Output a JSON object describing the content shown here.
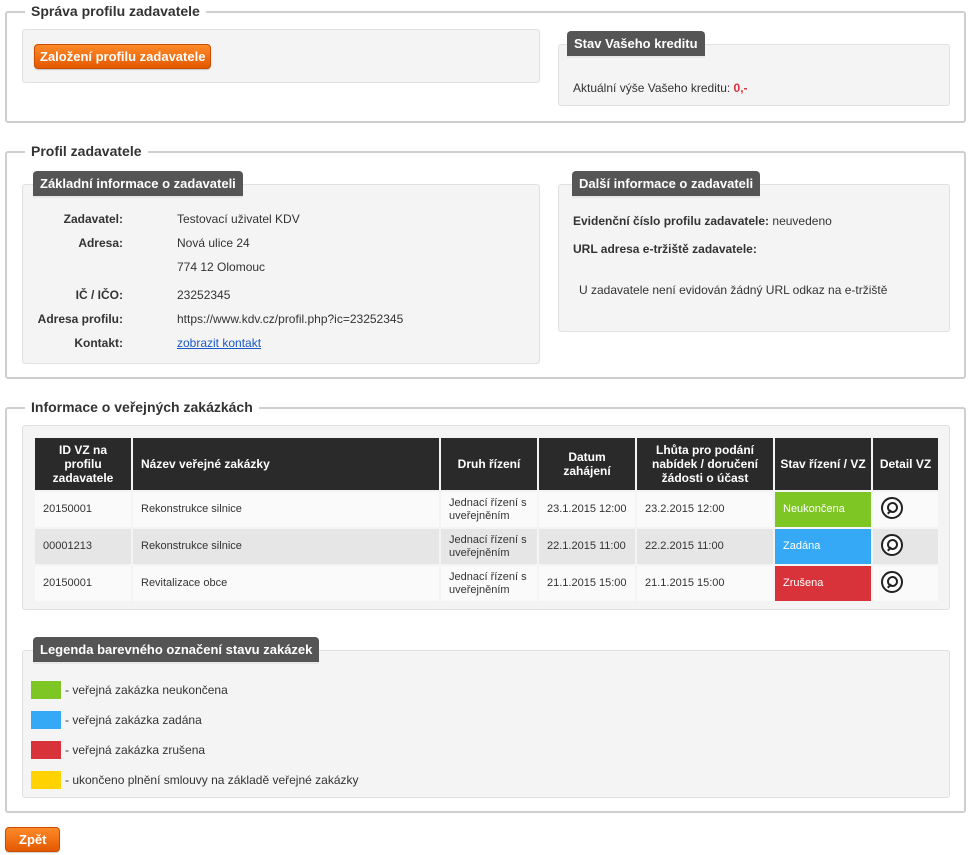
{
  "sprava": {
    "legend": "Správa profilu zadavatele",
    "create_button": "Založení profilu zadavatele",
    "credit_tab": "Stav Vašeho kreditu",
    "credit_label": "Aktuální výše Vašeho kreditu:",
    "credit_value": "0,-"
  },
  "profil": {
    "legend": "Profil zadavatele",
    "basic_tab": "Základní informace o zadavateli",
    "rows": [
      {
        "label": "Zadavatel:",
        "value": "Testovací uživatel KDV"
      },
      {
        "label": "Adresa:",
        "value": "Nová ulice 24"
      },
      {
        "label": "",
        "value": "774 12 Olomouc"
      },
      {
        "label": "IČ / IČO:",
        "value": "23252345"
      },
      {
        "label": "Adresa profilu:",
        "value": "https://www.kdv.cz/profil.php?ic=23252345"
      },
      {
        "label": "Kontakt:",
        "value": "zobrazit kontakt"
      }
    ],
    "more_tab": "Další informace o zadavateli",
    "evid_label": "Evidenční číslo profilu zadavatele:",
    "evid_value": "neuvedeno",
    "url_label": "URL adresa e-tržiště zadavatele:",
    "url_note": "U zadavatele není evidován žádný URL odkaz na e-tržiště"
  },
  "zakazky": {
    "legend": "Informace o veřejných zakázkách",
    "headers": [
      "ID VZ na profilu zadavatele",
      "Název veřejné zakázky",
      "Druh řízení",
      "Datum zahájení",
      "Lhůta pro podání nabídek / doručení žádosti o účast",
      "Stav řízení / VZ",
      "Detail VZ"
    ],
    "rows": [
      {
        "id": "20150001",
        "name": "Rekonstrukce silnice",
        "druh": "Jednací řízení s uveřejněním",
        "datum": "23.1.2015 12:00",
        "lhuta": "23.2.2015 12:00",
        "stav": "Neukončena",
        "color": "#7dc623"
      },
      {
        "id": "00001213",
        "name": "Rekonstrukce silnice",
        "druh": "Jednací řízení s uveřejněním",
        "datum": "22.1.2015 11:00",
        "lhuta": "22.2.2015 11:00",
        "stav": "Zadána",
        "color": "#35a9f5"
      },
      {
        "id": "20150001",
        "name": "Revitalizace obce",
        "druh": "Jednací řízení s uveřejněním",
        "datum": "21.1.2015 15:00",
        "lhuta": "21.1.2015 15:00",
        "stav": "Zrušena",
        "color": "#d8323a"
      }
    ],
    "legend_tab": "Legenda barevného označení stavu zakázek",
    "legend_items": [
      {
        "color": "#7dc623",
        "text": "- veřejná zakázka neukončena"
      },
      {
        "color": "#35a9f5",
        "text": "- veřejná zakázka zadána"
      },
      {
        "color": "#d8323a",
        "text": "- veřejná zakázka zrušena"
      },
      {
        "color": "#ffd200",
        "text": "- ukončeno plnění smlouvy na základě veřejné zakázky"
      }
    ]
  },
  "back_button": "Zpět"
}
